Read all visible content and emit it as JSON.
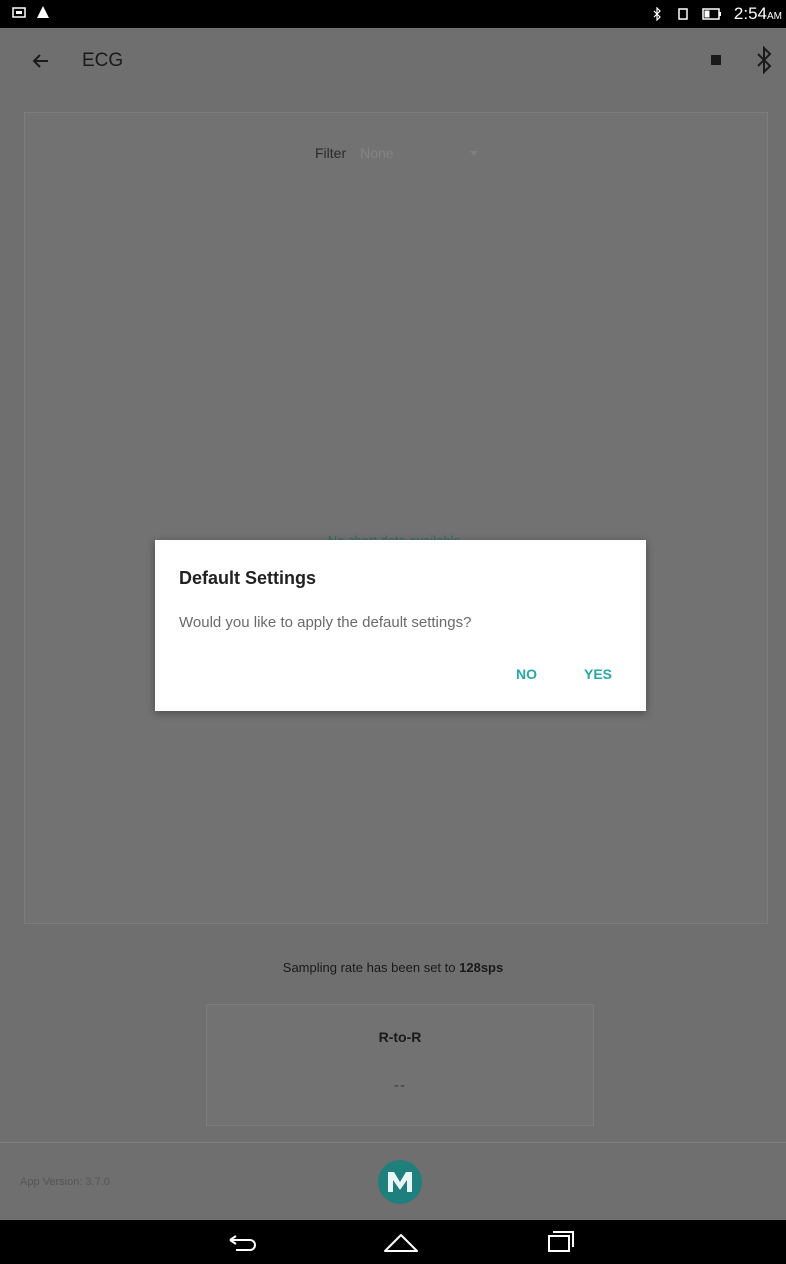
{
  "status_bar": {
    "time": "2:54",
    "ampm": "AM",
    "left_icons": [
      "screenshot-icon",
      "warning-icon"
    ],
    "right_icons": [
      "bluetooth-icon",
      "rotate-icon",
      "battery-icon"
    ]
  },
  "app_bar": {
    "title": "ECG",
    "back_icon": "arrow-left-icon",
    "stop_icon": "stop-square-icon",
    "bluetooth_icon": "bluetooth-icon"
  },
  "chart_card": {
    "filter_label": "Filter",
    "filter_value": "None",
    "no_data_text": "No chart data available."
  },
  "sampling": {
    "prefix": "Sampling rate has been set to ",
    "value": "128sps"
  },
  "rr_card": {
    "title": "R-to-R",
    "value": "--"
  },
  "footer": {
    "app_version": "App Version: 3.7.0",
    "logo_icon": "maxim-logo-icon"
  },
  "dialog": {
    "title": "Default Settings",
    "message": "Would you like to apply the default settings?",
    "no_label": "NO",
    "yes_label": "YES"
  },
  "nav_bar": {
    "icons": [
      "back-nav-icon",
      "home-nav-icon",
      "recents-nav-icon"
    ]
  },
  "colors": {
    "accent": "#26a8a8",
    "scrim_background": "#6f6f6f",
    "status_bar": "#000000"
  }
}
